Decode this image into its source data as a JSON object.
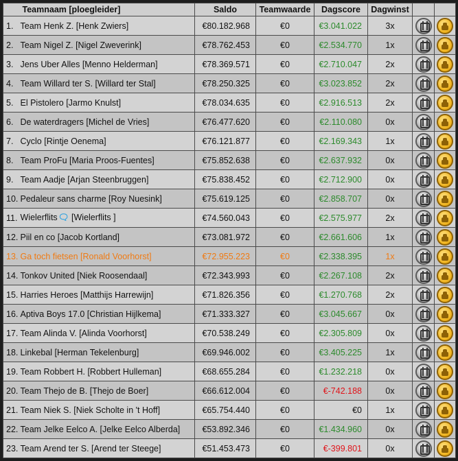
{
  "header": {
    "name": "Teamnaam [ploegleider]",
    "saldo": "Saldo",
    "waarde": "Teamwaarde",
    "score": "Dagscore",
    "wins": "Dagwinst"
  },
  "rows": [
    {
      "rank": "1.",
      "name": "Team Henk Z. [Henk Zwiers]",
      "saldo": "€80.182.968",
      "waarde": "€0",
      "score": "€3.041.022",
      "score_sign": "pos",
      "wins": "3x"
    },
    {
      "rank": "2.",
      "name": "Team Nigel Z. [Nigel Zweverink]",
      "saldo": "€78.762.453",
      "waarde": "€0",
      "score": "€2.534.770",
      "score_sign": "pos",
      "wins": "1x"
    },
    {
      "rank": "3.",
      "name": "Jens Uber Alles [Menno Helderman]",
      "saldo": "€78.369.571",
      "waarde": "€0",
      "score": "€2.710.047",
      "score_sign": "pos",
      "wins": "2x"
    },
    {
      "rank": "4.",
      "name": "Team Willard ter S. [Willard ter Stal]",
      "saldo": "€78.250.325",
      "waarde": "€0",
      "score": "€3.023.852",
      "score_sign": "pos",
      "wins": "2x"
    },
    {
      "rank": "5.",
      "name": "El Pistolero [Jarmo Knulst]",
      "saldo": "€78.034.635",
      "waarde": "€0",
      "score": "€2.916.513",
      "score_sign": "pos",
      "wins": "2x"
    },
    {
      "rank": "6.",
      "name": "De waterdragers [Michel de Vries]",
      "saldo": "€76.477.620",
      "waarde": "€0",
      "score": "€2.110.080",
      "score_sign": "pos",
      "wins": "0x"
    },
    {
      "rank": "7.",
      "name": "Cyclo [Rintje Oenema]",
      "saldo": "€76.121.877",
      "waarde": "€0",
      "score": "€2.169.343",
      "score_sign": "pos",
      "wins": "1x"
    },
    {
      "rank": "8.",
      "name": "Team ProFu [Maria Proos-Fuentes]",
      "saldo": "€75.852.638",
      "waarde": "€0",
      "score": "€2.637.932",
      "score_sign": "pos",
      "wins": "0x"
    },
    {
      "rank": "9.",
      "name": "Team Aadje [Arjan Steenbruggen]",
      "saldo": "€75.838.452",
      "waarde": "€0",
      "score": "€2.712.900",
      "score_sign": "pos",
      "wins": "0x"
    },
    {
      "rank": "10.",
      "name": "Pedaleur sans charme [Roy Nuesink]",
      "saldo": "€75.619.125",
      "waarde": "€0",
      "score": "€2.858.707",
      "score_sign": "pos",
      "wins": "0x"
    },
    {
      "rank": "11.",
      "name": "Wielerflits",
      "name_suffix": " [Wielerflits ]",
      "saldo": "€74.560.043",
      "waarde": "€0",
      "score": "€2.575.977",
      "score_sign": "pos",
      "wins": "2x"
    },
    {
      "rank": "12.",
      "name": "Piil en co [Jacob Kortland]",
      "saldo": "€73.081.972",
      "waarde": "€0",
      "score": "€2.661.606",
      "score_sign": "pos",
      "wins": "1x"
    },
    {
      "rank": "13.",
      "name": "Ga toch fietsen [Ronald Voorhorst]",
      "saldo": "€72.955.223",
      "waarde": "€0",
      "score": "€2.338.395",
      "score_sign": "pos",
      "wins": "1x",
      "me": true
    },
    {
      "rank": "14.",
      "name": "Tonkov United [Niek Roosendaal]",
      "saldo": "€72.343.993",
      "waarde": "€0",
      "score": "€2.267.108",
      "score_sign": "pos",
      "wins": "2x"
    },
    {
      "rank": "15.",
      "name": "Harries Heroes [Matthijs Harrewijn]",
      "saldo": "€71.826.356",
      "waarde": "€0",
      "score": "€1.270.768",
      "score_sign": "pos",
      "wins": "2x"
    },
    {
      "rank": "16.",
      "name": "Aptiva Boys 17.0 [Christian Hijlkema]",
      "saldo": "€71.333.327",
      "waarde": "€0",
      "score": "€3.045.667",
      "score_sign": "pos",
      "wins": "0x"
    },
    {
      "rank": "17.",
      "name": "Team Alinda V. [Alinda Voorhorst]",
      "saldo": "€70.538.249",
      "waarde": "€0",
      "score": "€2.305.809",
      "score_sign": "pos",
      "wins": "0x"
    },
    {
      "rank": "18.",
      "name": "Linkebal [Herman Tekelenburg]",
      "saldo": "€69.946.002",
      "waarde": "€0",
      "score": "€3.405.225",
      "score_sign": "pos",
      "wins": "1x"
    },
    {
      "rank": "19.",
      "name": "Team Robbert H. [Robbert Hulleman]",
      "saldo": "€68.655.284",
      "waarde": "€0",
      "score": "€1.232.218",
      "score_sign": "pos",
      "wins": "0x"
    },
    {
      "rank": "20.",
      "name": "Team Thejo de B. [Thejo de Boer]",
      "saldo": "€66.612.004",
      "waarde": "€0",
      "score": "€-742.188",
      "score_sign": "neg",
      "wins": "0x"
    },
    {
      "rank": "21.",
      "name": "Team Niek S. [Niek Scholte in 't Hoff]",
      "saldo": "€65.754.440",
      "waarde": "€0",
      "score": "€0",
      "score_sign": "neu",
      "wins": "1x"
    },
    {
      "rank": "22.",
      "name": "Team Jelke Eelco A. [Jelke Eelco Alberda]",
      "saldo": "€53.892.346",
      "waarde": "€0",
      "score": "€1.434.960",
      "score_sign": "pos",
      "wins": "0x"
    },
    {
      "rank": "23.",
      "name": "Team Arend ter S. [Arend ter Steege]",
      "saldo": "€51.453.473",
      "waarde": "€0",
      "score": "€-399.801",
      "score_sign": "neg",
      "wins": "0x"
    }
  ],
  "icons": {
    "team": "team-shirt-icon",
    "cash": "money-bag-icon"
  },
  "colors": {
    "positive": "#2c8a2c",
    "negative": "#e0141a",
    "highlight": "#f07a12"
  }
}
